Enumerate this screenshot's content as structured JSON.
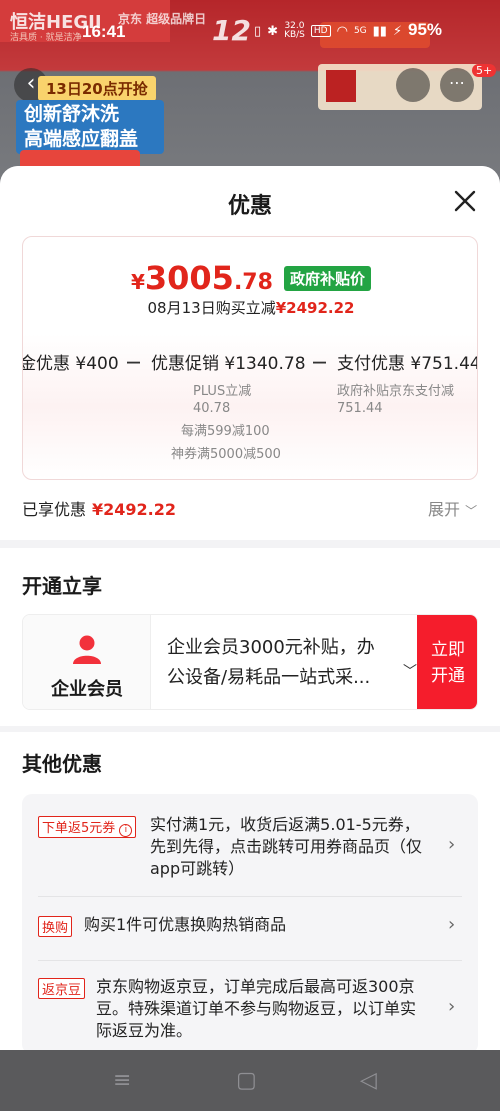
{
  "status_bar": {
    "time": "16:41",
    "network_speed_value": "32.0",
    "network_speed_unit": "KB/S",
    "hd_label": "HD",
    "signal_label": "5G",
    "battery": "95%"
  },
  "background": {
    "brand": "恒洁HEGII",
    "brand_sub": "洁具质 · 就是洁净",
    "badge": "京东 超级品牌日",
    "big_number": "12",
    "date_tag": "13日20点开抢",
    "feature_line1": "创新舒沐洗",
    "feature_line2": "高端感应翻盖",
    "notif_count": "5+"
  },
  "sheet": {
    "title": "优惠",
    "final_price": {
      "currency": "¥",
      "integer": "3005",
      "decimal": ".78",
      "badge": "政府补贴价"
    },
    "discount_line": {
      "prefix": "08月13日购买立减",
      "amount": "¥2492.22"
    },
    "breakdown": {
      "left_label": "金优惠 ¥400",
      "minus1": "－",
      "middle_label": "优惠促销 ¥1340.78",
      "minus2": "－",
      "right_label": "支付优惠 ¥751.44",
      "middle_sub1": "PLUS立减",
      "middle_sub1_value": "40.78",
      "middle_sub2": "每满599减100",
      "middle_sub3": "神券满5000减500",
      "right_sub1": "政府补贴京东支付减",
      "right_sub1_value": "751.44"
    },
    "enjoyed_label": "已享优惠",
    "enjoyed_amount": "¥2492.22",
    "expand_label": "展开"
  },
  "member": {
    "section_title": "开通立享",
    "name": "企业会员",
    "desc_line1": "企业会员3000元补贴，办",
    "desc_line2": "公设备/易耗品一站式采...",
    "button_line1": "立即",
    "button_line2": "开通"
  },
  "other": {
    "section_title": "其他优惠",
    "offers": [
      {
        "tag": "下单返5元券",
        "lines": [
          "实付满1元，收货后返满5.01-5元券，",
          "先到先得，点击跳转可用券商品页（仅",
          "app可跳转）"
        ]
      },
      {
        "tag": "换购",
        "lines": [
          "购买1件可优惠换购热销商品"
        ]
      },
      {
        "tag": "返京豆",
        "lines": [
          "京东购物返京豆，订单完成后最高可返300京",
          "豆。特殊渠道订单不参与购物返豆，以订单实",
          "际返豆为准。"
        ]
      }
    ]
  },
  "nav": {
    "menu_icon": "≡",
    "home_icon": "▢",
    "back_icon": "◁"
  },
  "colors": {
    "accent_red": "#e1251b",
    "member_button": "#f51d2c",
    "gov_badge": "#23a443"
  }
}
